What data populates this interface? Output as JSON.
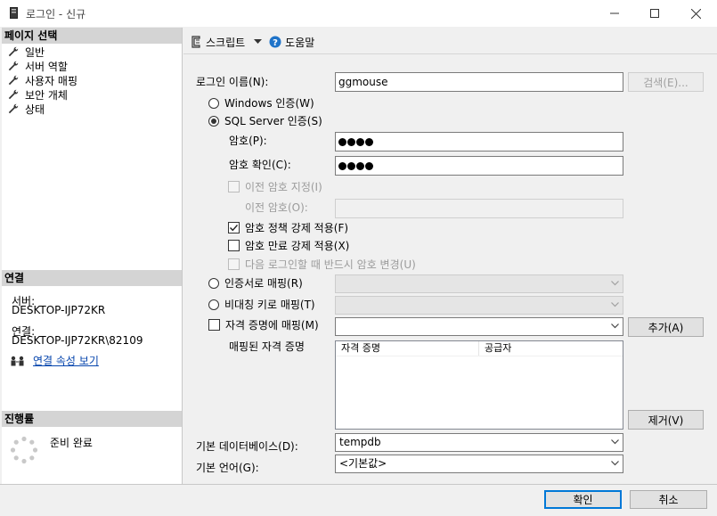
{
  "window": {
    "title": "로그인 - 신규",
    "minimize_icon": "minimize-icon",
    "maximize_icon": "maximize-icon",
    "close_icon": "close-icon"
  },
  "sidebar": {
    "page_select_header": "페이지 선택",
    "items": [
      {
        "label": "일반",
        "icon": "wrench-icon"
      },
      {
        "label": "서버 역할",
        "icon": "wrench-icon"
      },
      {
        "label": "사용자 매핑",
        "icon": "wrench-icon"
      },
      {
        "label": "보안 개체",
        "icon": "wrench-icon"
      },
      {
        "label": "상태",
        "icon": "wrench-icon"
      }
    ],
    "connection_header": "연결",
    "server_label": "서버:",
    "server_value": "DESKTOP-IJP72KR",
    "connection_label": "연결:",
    "connection_value": "DESKTOP-IJP72KR\\82109",
    "view_connection_props": "연결 속성 보기",
    "progress_header": "진행률",
    "progress_status": "준비 완료"
  },
  "toolbar": {
    "script_label": "스크립트",
    "help_label": "도움말"
  },
  "form": {
    "login_name_label": "로그인 이름(N):",
    "login_name_value": "ggmouse",
    "search_button": "검색(E)...",
    "windows_auth": "Windows 인증(W)",
    "sql_auth": "SQL Server 인증(S)",
    "password_label": "암호(P):",
    "password_dots": 4,
    "confirm_password_label": "암호 확인(C):",
    "confirm_password_dots": 4,
    "specify_old_password": "이전 암호 지정(I)",
    "old_password_label": "이전 암호(O):",
    "enforce_policy": "암호 정책 강제 적용(F)",
    "enforce_policy_checked": true,
    "enforce_expiration": "암호 만료 강제 적용(X)",
    "enforce_expiration_checked": false,
    "must_change": "다음 로그인할 때 반드시 암호 변경(U)",
    "map_certificate": "인증서로 매핑(R)",
    "map_asymmetric_key": "비대칭 키로 매핑(T)",
    "map_credential": "자격 증명에 매핑(M)",
    "add_button": "추가(A)",
    "mapped_credentials_label": "매핑된 자격 증명",
    "credential_columns": [
      "자격 증명",
      "공급자"
    ],
    "remove_button": "제거(V)",
    "default_db_label": "기본 데이터베이스(D):",
    "default_db_value": "tempdb",
    "default_lang_label": "기본 언어(G):",
    "default_lang_value": "<기본값>"
  },
  "footer": {
    "ok_button": "확인",
    "cancel_button": "취소"
  }
}
